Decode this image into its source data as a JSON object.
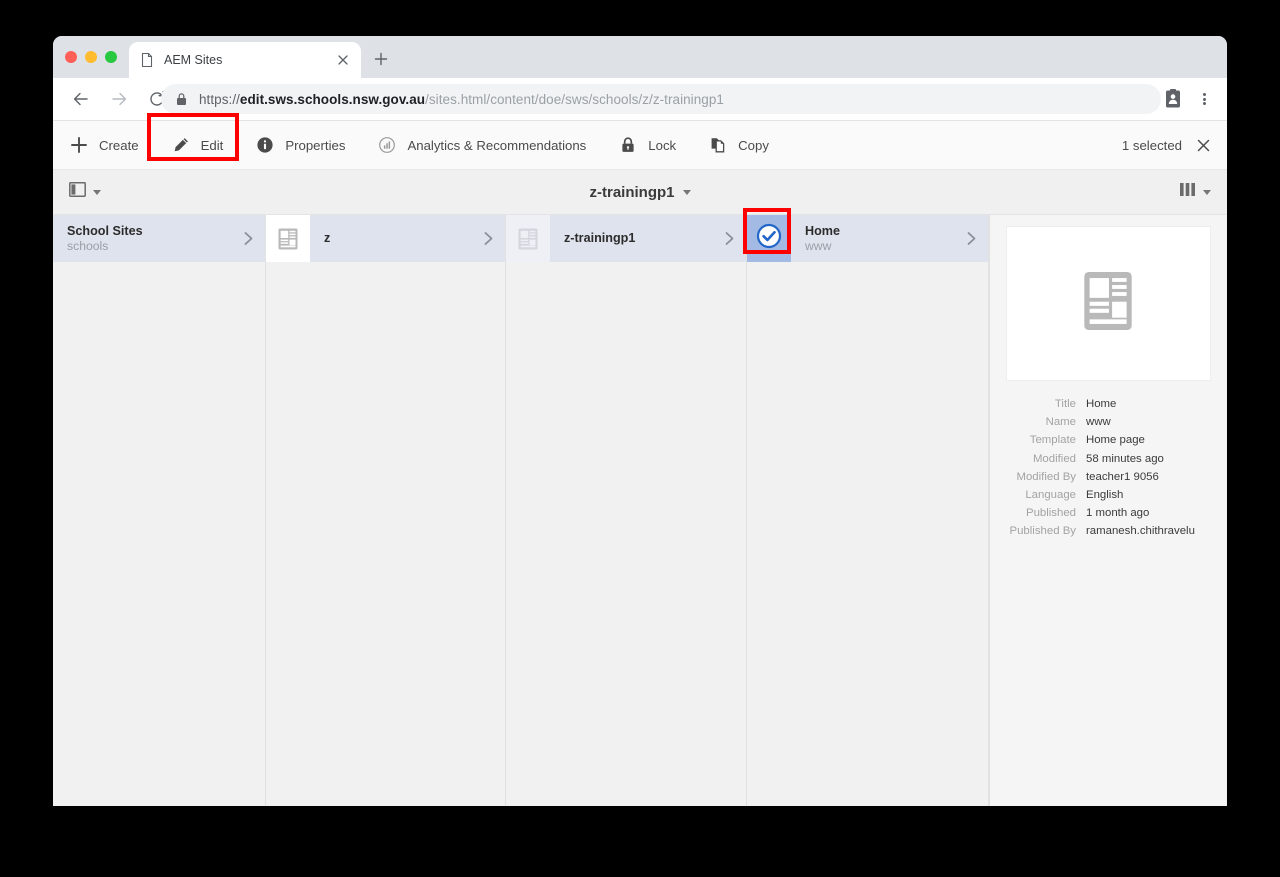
{
  "browser": {
    "tab": {
      "title": "AEM Sites",
      "favicon_icon": "page-icon",
      "close_icon": "close-icon"
    },
    "new_tab_icon": "plus-icon",
    "nav": {
      "back_icon": "arrow-left-icon",
      "forward_icon": "arrow-right-icon",
      "reload_icon": "reload-icon"
    },
    "omnibox": {
      "lock_icon": "lock-icon",
      "scheme": "https://",
      "domain": "edit.sws.schools.nsw.gov.au",
      "path": "/sites.html/content/doe/sws/schools/z/z-trainingp1",
      "full_url": "https://edit.sws.schools.nsw.gov.au/sites.html/content/doe/sws/schools/z/z-trainingp1"
    },
    "profile_icon": "profile-card-icon",
    "menu_icon": "kebab-menu-icon"
  },
  "toolbar": {
    "items": [
      {
        "label": "Create",
        "icon": "plus-icon"
      },
      {
        "label": "Edit",
        "icon": "pencil-icon"
      },
      {
        "label": "Properties",
        "icon": "info-icon"
      },
      {
        "label": "Analytics & Recommendations",
        "icon": "analytics-icon"
      },
      {
        "label": "Lock",
        "icon": "padlock-icon"
      },
      {
        "label": "Copy",
        "icon": "copy-icon"
      }
    ],
    "selection_status": "1 selected",
    "clear_icon": "close-icon"
  },
  "header": {
    "rail_toggle_icon": "left-rail-icon",
    "title": "z-trainingp1",
    "title_caret_icon": "chevron-down-icon",
    "view_switcher_icon": "column-view-icon",
    "view_caret_icon": "chevron-down-icon"
  },
  "columns": [
    {
      "name": "school-sites",
      "title": "School Sites",
      "subtitle": "schools",
      "thumb_icon": "none",
      "chevron_icon": "chevron-right-icon",
      "selected": false
    },
    {
      "name": "z",
      "title": "z",
      "subtitle": "",
      "thumb_icon": "page-layout-icon",
      "chevron_icon": "chevron-right-icon",
      "selected": false
    },
    {
      "name": "z-trainingp1",
      "title": "z-trainingp1",
      "subtitle": "",
      "thumb_icon": "page-layout-icon",
      "chevron_icon": "chevron-right-icon",
      "selected": false
    },
    {
      "name": "home",
      "title": "Home",
      "subtitle": "www",
      "thumb_icon": "check-circle-icon",
      "chevron_icon": "chevron-right-icon",
      "selected": true
    }
  ],
  "detail": {
    "thumbnail_icon": "page-layout-icon",
    "fields": [
      {
        "label": "Title",
        "value": "Home"
      },
      {
        "label": "Name",
        "value": "www"
      },
      {
        "label": "Template",
        "value": "Home page"
      },
      {
        "label": "Modified",
        "value": "58 minutes ago"
      },
      {
        "label": "Modified By",
        "value": "teacher1 9056"
      },
      {
        "label": "Language",
        "value": "English"
      },
      {
        "label": "Published",
        "value": "1 month ago"
      },
      {
        "label": "Published By",
        "value": "ramanesh.chithravelu"
      }
    ]
  },
  "annotations": {
    "edit_highlight_color": "#fe0000",
    "selection_highlight_color": "#fe0000"
  }
}
